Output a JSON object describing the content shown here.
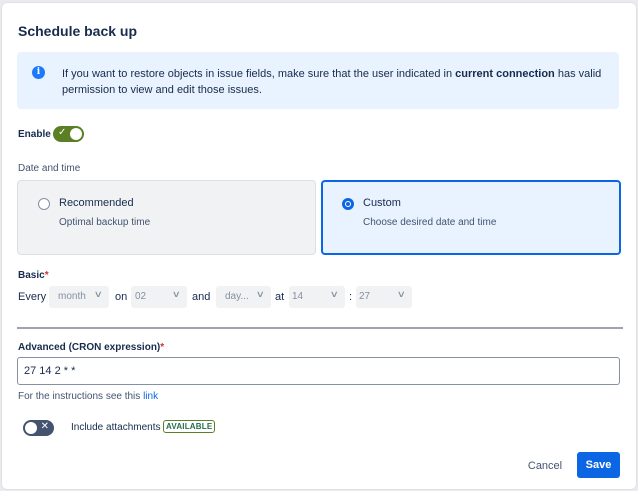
{
  "dialog": {
    "title": "Schedule back up"
  },
  "info": {
    "text_before": "If you want to restore objects in issue fields, make sure that the user indicated in ",
    "text_bold": "current connection",
    "text_after": " has valid permission to view and edit those issues."
  },
  "enable": {
    "label": "Enable",
    "on": true
  },
  "date_time": {
    "label": "Date and time",
    "options": [
      {
        "title": "Recommended",
        "subtitle": "Optimal backup time",
        "selected": false
      },
      {
        "title": "Custom",
        "subtitle": "Choose desired date and time",
        "selected": true
      }
    ]
  },
  "basic": {
    "label": "Basic",
    "required_mark": "*",
    "every": "Every",
    "period": "month",
    "on": "on",
    "day": "02",
    "and": "and",
    "weekday": "day...",
    "at": "at",
    "hour": "14",
    "colon": ":",
    "minute": "27"
  },
  "advanced": {
    "label": "Advanced (CRON expression)",
    "required_mark": "*",
    "value": "27 14 2 * *",
    "help_text": "For the instructions see this ",
    "help_link": "link"
  },
  "attachments": {
    "label": "Include attachments",
    "badge": "AVAILABLE",
    "on": false
  },
  "footer": {
    "cancel": "Cancel",
    "save": "Save"
  },
  "colors": {
    "primary": "#0c66e4",
    "toggle_on": "#5b7f24",
    "info_bg": "#e9f2ff"
  }
}
